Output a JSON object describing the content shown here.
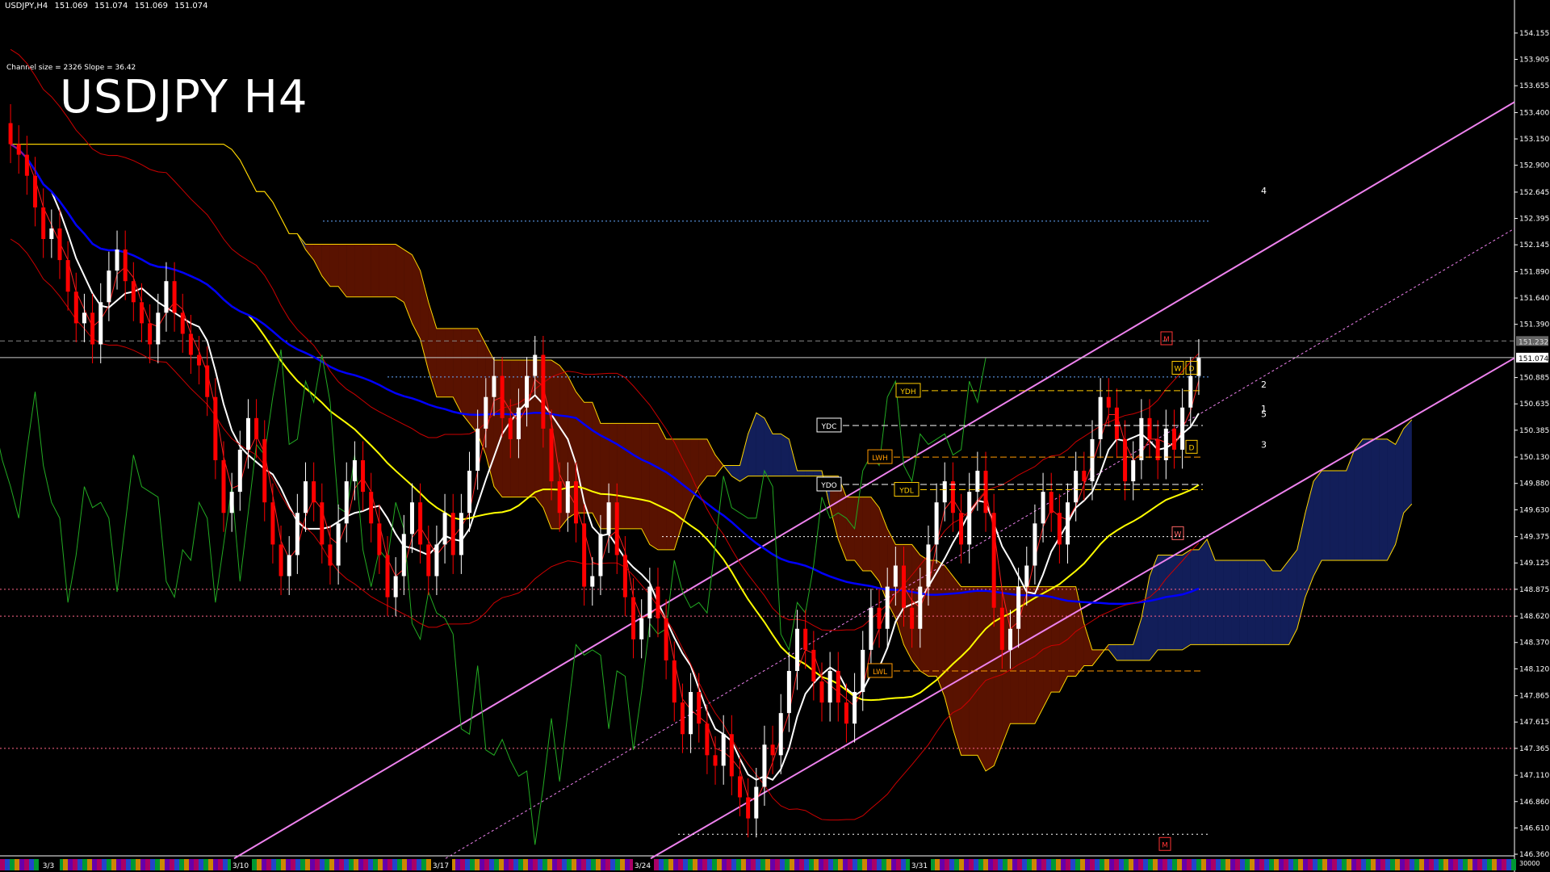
{
  "header": {
    "symbol_tf": "USDJPY,H4",
    "open": "151.069",
    "high": "151.074",
    "low": "151.069",
    "close": "151.074"
  },
  "channel_info": "Channel size = 2326 Slope = 36.42",
  "title": "USDJPY H4",
  "chart_data": {
    "type": "candlestick",
    "symbol": "USDJPY",
    "timeframe": "H4",
    "current_price": 151.074,
    "ask_marker": 151.232,
    "ylim": [
      146.36,
      154.3
    ],
    "y_ticks": [
      154.155,
      153.905,
      153.655,
      153.4,
      153.15,
      152.9,
      152.645,
      152.395,
      152.145,
      151.89,
      151.64,
      151.39,
      150.885,
      150.635,
      150.385,
      150.13,
      149.88,
      149.63,
      149.375,
      149.125,
      148.875,
      148.62,
      148.37,
      148.12,
      147.865,
      147.615,
      147.365,
      147.11,
      146.86,
      146.61,
      146.36
    ],
    "x_date_labels": [
      "3/3",
      "3/10",
      "3/17",
      "3/24",
      "3/31"
    ],
    "volume_label": "30000",
    "closes": [
      153.1,
      153.0,
      152.8,
      152.5,
      152.2,
      152.3,
      152.0,
      151.7,
      151.4,
      151.5,
      151.2,
      151.6,
      151.9,
      152.1,
      151.8,
      151.6,
      151.4,
      151.2,
      151.5,
      151.8,
      151.5,
      151.3,
      151.1,
      151.0,
      150.7,
      150.1,
      149.6,
      149.8,
      150.2,
      150.5,
      150.3,
      149.7,
      149.3,
      149.0,
      149.2,
      149.6,
      149.9,
      149.7,
      149.3,
      149.1,
      149.5,
      149.9,
      150.1,
      149.8,
      149.5,
      149.2,
      148.8,
      149.0,
      149.4,
      149.7,
      149.3,
      149.0,
      149.3,
      149.6,
      149.2,
      149.6,
      150.0,
      150.4,
      150.7,
      150.9,
      150.5,
      150.3,
      150.6,
      150.9,
      151.1,
      150.4,
      149.9,
      149.6,
      149.9,
      149.5,
      148.9,
      149.0,
      149.4,
      149.7,
      149.2,
      148.8,
      148.4,
      148.6,
      148.9,
      148.6,
      148.2,
      147.8,
      147.5,
      147.9,
      147.6,
      147.3,
      147.2,
      147.5,
      147.1,
      146.9,
      146.7,
      147.0,
      147.4,
      147.3,
      147.7,
      148.1,
      148.5,
      148.3,
      148.0,
      147.8,
      148.1,
      147.8,
      147.6,
      147.9,
      148.3,
      148.7,
      148.5,
      148.9,
      149.1,
      148.7,
      148.5,
      148.9,
      149.3,
      149.7,
      149.9,
      149.6,
      149.3,
      149.8,
      150.0,
      149.6,
      148.7,
      148.3,
      148.5,
      148.9,
      149.1,
      149.5,
      149.8,
      149.6,
      149.3,
      149.7,
      150.0,
      149.9,
      150.3,
      150.7,
      150.6,
      150.3,
      149.9,
      150.1,
      150.5,
      150.3,
      150.1,
      150.4,
      150.2,
      150.6,
      150.9,
      151.07
    ],
    "moving_averages": [
      {
        "color": "#ffffff",
        "period": "fast"
      },
      {
        "color": "#ffff00",
        "period": "mid"
      },
      {
        "color": "#0000ff",
        "period": "slow"
      },
      {
        "color": "#ff0000",
        "period": "bands"
      }
    ],
    "levels": [
      {
        "label": "YDH",
        "price": 150.76
      },
      {
        "label": "YDC",
        "price": 150.43
      },
      {
        "label": "LWH",
        "price": 150.13
      },
      {
        "label": "YDO",
        "price": 149.87
      },
      {
        "label": "YDL",
        "price": 149.82
      },
      {
        "label": "LWL",
        "price": 148.1
      }
    ],
    "markers": [
      "M",
      "W",
      "D",
      "D",
      "W",
      "M"
    ],
    "projection_labels": [
      "4",
      "2",
      "1",
      "5",
      "3"
    ],
    "colors": {
      "background": "#000000",
      "bull_candle": "#ffffff",
      "bear_candle": "#ff0000",
      "channel": "#ee82ee",
      "cloud": "#ff3300",
      "cloud_bull": "#3355ff"
    }
  }
}
